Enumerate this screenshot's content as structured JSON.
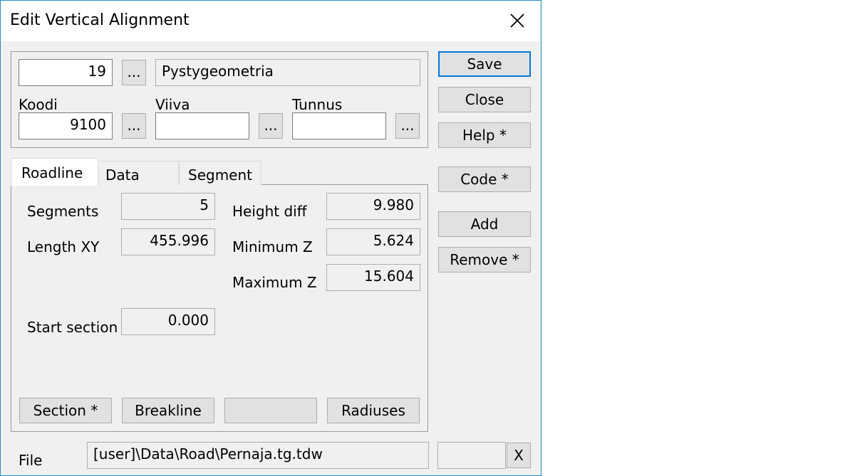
{
  "window": {
    "title": "Edit Vertical Alignment"
  },
  "header": {
    "id_value": "19",
    "browse": "...",
    "name_value": "Pystygeometria",
    "koodi_label": "Koodi",
    "koodi_value": "9100",
    "viiva_label": "Viiva",
    "viiva_value": "",
    "tunnus_label": "Tunnus",
    "tunnus_value": ""
  },
  "side_buttons": {
    "save": "Save",
    "close": "Close",
    "help": "Help *",
    "code": "Code *",
    "add": "Add",
    "remove": "Remove *"
  },
  "tabs": [
    "Roadline",
    "Data",
    "Segment"
  ],
  "roadline": {
    "segments_label": "Segments",
    "segments_value": "5",
    "length_label": "Length XY",
    "length_value": "455.996",
    "height_diff_label": "Height diff",
    "height_diff_value": "9.980",
    "min_z_label": "Minimum Z",
    "min_z_value": "5.624",
    "max_z_label": "Maximum Z",
    "max_z_value": "15.604",
    "start_section_label": "Start section",
    "start_section_value": "0.000",
    "buttons": {
      "section": "Section *",
      "breakline": "Breakline",
      "blank": "",
      "radiuses": "Radiuses"
    }
  },
  "file": {
    "label": "File",
    "path": "[user]\\Data\\Road\\Pernaja.tg.tdw",
    "extra": "",
    "clear": "X"
  }
}
